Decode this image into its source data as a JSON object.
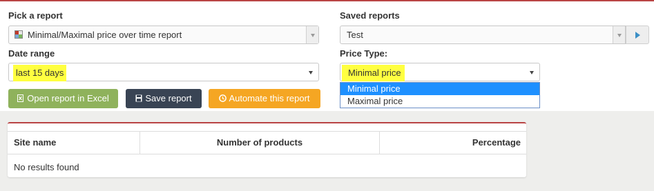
{
  "pick_report": {
    "label": "Pick a report",
    "selected": "Minimal/Maximal price over time report",
    "icon": "report-grid-icon"
  },
  "saved_reports": {
    "label": "Saved reports",
    "selected": "Test",
    "run_icon": "play-icon"
  },
  "date_range": {
    "label": "Date range",
    "selected": "last 15 days"
  },
  "price_type": {
    "label": "Price Type:",
    "selected": "Minimal price",
    "options": [
      "Minimal price",
      "Maximal price"
    ],
    "highlighted_option": "Minimal price"
  },
  "actions": {
    "excel_label": "Open report in Excel",
    "save_label": "Save report",
    "automate_label": "Automate this report"
  },
  "table": {
    "columns": [
      "Site name",
      "Number of products",
      "Percentage"
    ],
    "empty_message": "No results found"
  },
  "colors": {
    "accent_red": "#b94444",
    "excel_green": "#8fb25c",
    "save_dark": "#394454",
    "automate_orange": "#f5a623",
    "highlight_yellow": "#ffff40",
    "dropdown_selected": "#1e90ff"
  }
}
